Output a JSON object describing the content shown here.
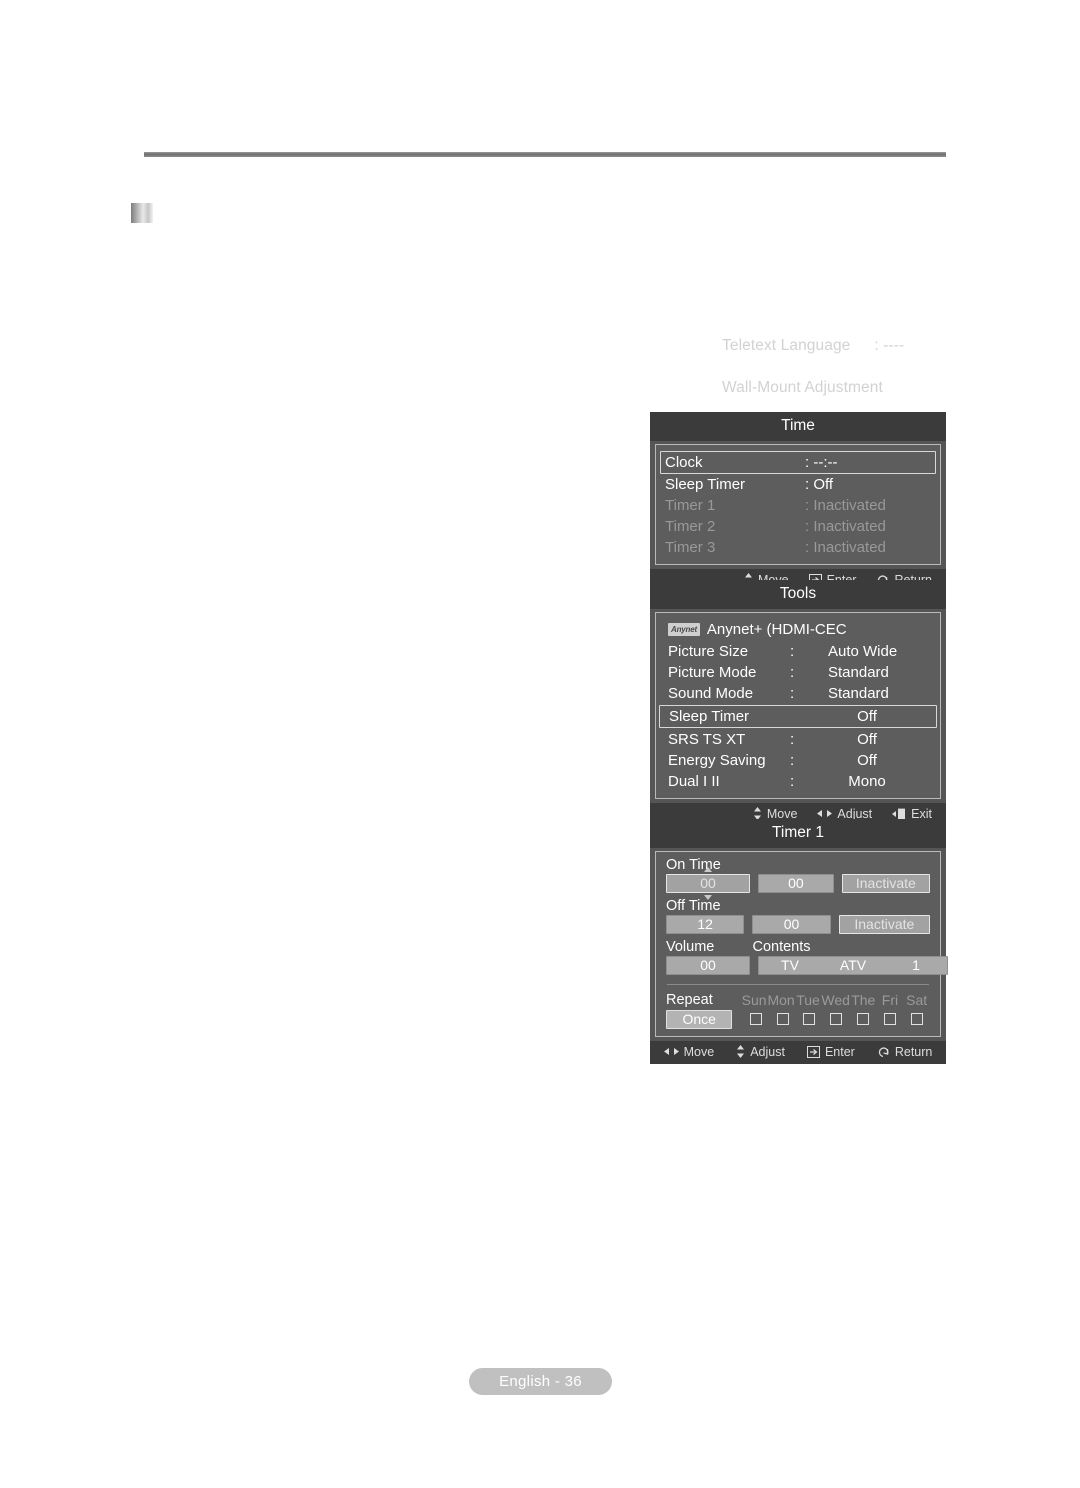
{
  "document": {
    "page_badge": "English - 36"
  },
  "faded_menu": {
    "teletext_language_label": "Teletext Language",
    "teletext_language_value": ": ----",
    "wall_mount_adjustment": "Wall-Mount Adjustment"
  },
  "time_panel": {
    "title": "Time",
    "rows": [
      {
        "label": "Clock",
        "value": ": --:--",
        "selected": true,
        "dim": false
      },
      {
        "label": "Sleep Timer",
        "value": ": Off",
        "selected": false,
        "dim": false
      },
      {
        "label": "Timer 1",
        "value": ": Inactivated",
        "selected": false,
        "dim": true
      },
      {
        "label": "Timer 2",
        "value": ": Inactivated",
        "selected": false,
        "dim": true
      },
      {
        "label": "Timer 3",
        "value": ": Inactivated",
        "selected": false,
        "dim": true
      }
    ],
    "footer": [
      {
        "icon": "updown-arrow-icon",
        "label": "Move"
      },
      {
        "icon": "enter-icon",
        "label": "Enter"
      },
      {
        "icon": "return-icon",
        "label": "Return"
      }
    ]
  },
  "tools_panel": {
    "title": "Tools",
    "anynet": {
      "badge_text": "Anynet",
      "label": "Anynet+ (HDMI-CEC"
    },
    "rows": [
      {
        "key": "Picture Size",
        "colon": ":",
        "value": "Auto Wide",
        "selected": false
      },
      {
        "key": "Picture Mode",
        "colon": ":",
        "value": "Standard",
        "selected": false
      },
      {
        "key": "Sound Mode",
        "colon": ":",
        "value": "Standard",
        "selected": false
      },
      {
        "key": "Sleep Timer",
        "colon": "",
        "value": "Off",
        "selected": true
      },
      {
        "key": "SRS TS XT",
        "colon": ":",
        "value": "Off",
        "selected": false
      },
      {
        "key": "Energy Saving",
        "colon": ":",
        "value": "Off",
        "selected": false
      },
      {
        "key": "Dual I II",
        "colon": ":",
        "value": "Mono",
        "selected": false
      }
    ],
    "footer": [
      {
        "icon": "updown-arrow-icon",
        "label": "Move"
      },
      {
        "icon": "leftright-arrow-icon",
        "label": "Adjust"
      },
      {
        "icon": "exit-icon",
        "label": "Exit"
      }
    ]
  },
  "timer_panel": {
    "title": "Timer 1",
    "on_time": {
      "label": "On Time",
      "hour": "00",
      "minute": "00",
      "state": "Inactivate"
    },
    "off_time": {
      "label": "Off Time",
      "hour": "12",
      "minute": "00",
      "state": "Inactivate"
    },
    "volume": {
      "label": "Volume",
      "value": "00"
    },
    "contents": {
      "label": "Contents",
      "source": "TV",
      "mode": "ATV",
      "channel": "1"
    },
    "repeat": {
      "label": "Repeat",
      "mode": "Once",
      "days": [
        "Sun",
        "Mon",
        "Tue",
        "Wed",
        "The",
        "Fri",
        "Sat"
      ],
      "checked": [
        false,
        false,
        false,
        false,
        false,
        false,
        false
      ]
    },
    "footer": [
      {
        "icon": "leftright-arrow-icon",
        "label": "Move"
      },
      {
        "icon": "updown-arrow-icon",
        "label": "Adjust"
      },
      {
        "icon": "enter-icon",
        "label": "Enter"
      },
      {
        "icon": "return-icon",
        "label": "Return"
      }
    ]
  },
  "colors": {
    "panel_body": "#5d5d5d",
    "panel_title_bar": "#3b3b3b",
    "field_fill": "#a9a9a9",
    "dim_text": "#999999",
    "faded_text": "#d2d2d2",
    "badge_bg": "#c0c0c0"
  }
}
